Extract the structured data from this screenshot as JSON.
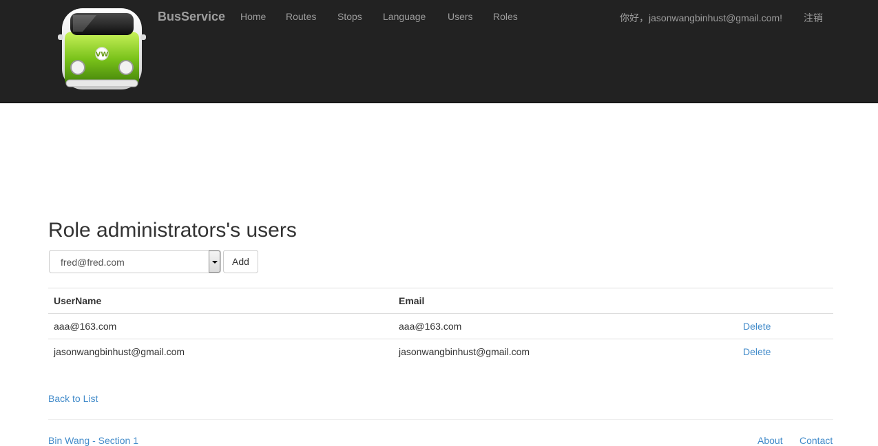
{
  "navbar": {
    "brand": "BusService",
    "items": [
      {
        "label": "Home"
      },
      {
        "label": "Routes"
      },
      {
        "label": "Stops"
      },
      {
        "label": "Language"
      },
      {
        "label": "Users"
      },
      {
        "label": "Roles"
      }
    ],
    "greeting": "你好，jasonwangbinhust@gmail.com!",
    "logout_label": "注销",
    "logo_icon": "vw-bus-logo-icon"
  },
  "page": {
    "title": "Role administrators's users",
    "user_select": {
      "selected": "fred@fred.com"
    },
    "add_label": "Add",
    "table": {
      "headers": [
        "UserName",
        "Email",
        ""
      ],
      "rows": [
        {
          "username": "aaa@163.com",
          "email": "aaa@163.com",
          "action": "Delete"
        },
        {
          "username": "jasonwangbinhust@gmail.com",
          "email": "jasonwangbinhust@gmail.com",
          "action": "Delete"
        }
      ]
    },
    "back_link": "Back to List"
  },
  "footer": {
    "left_text": "Bin Wang - Section 1",
    "about": "About",
    "contact": "Contact"
  },
  "colors": {
    "navbar_bg": "#222222",
    "nav_text": "#9d9d9d",
    "link": "#428bca",
    "bus_green": "#7fc41e"
  }
}
